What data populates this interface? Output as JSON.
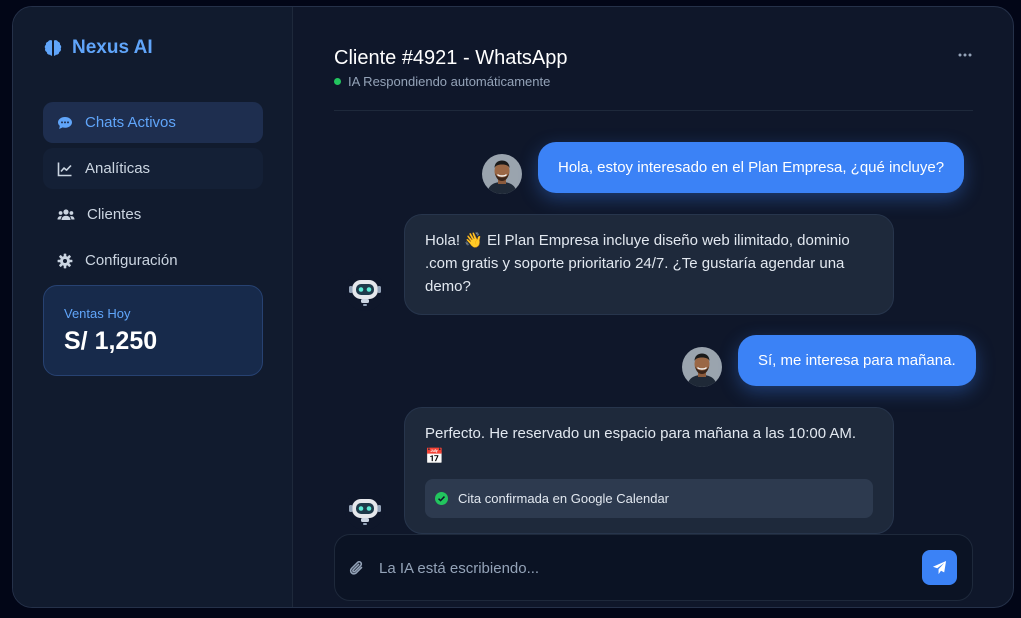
{
  "brand": {
    "name": "Nexus AI",
    "icon": "brain-icon",
    "color": "#60a5fa"
  },
  "nav": [
    {
      "label": "Chats Activos",
      "icon": "comment-icon",
      "active": true
    },
    {
      "label": "Analíticas",
      "icon": "chart-line-icon",
      "active": false
    },
    {
      "label": "Clientes",
      "icon": "users-icon",
      "active": false
    },
    {
      "label": "Configuración",
      "icon": "gear-icon",
      "active": false
    }
  ],
  "sales": {
    "label": "Ventas Hoy",
    "value": "S/ 1,250"
  },
  "chat": {
    "title": "Cliente #4921 - WhatsApp",
    "status": "IA Respondiendo automáticamente",
    "status_color": "#22c55e"
  },
  "messages": [
    {
      "from": "user",
      "text": "Hola, estoy interesado en el Plan Empresa, ¿qué incluye?"
    },
    {
      "from": "ai",
      "text": "Hola! 👋 El Plan Empresa incluye diseño web ilimitado, dominio .com gratis y soporte prioritario 24/7. ¿Te gustaría agendar una demo?"
    },
    {
      "from": "user",
      "text": "Sí, me interesa para mañana."
    },
    {
      "from": "ai",
      "text": "Perfecto. He reservado un espacio para mañana a las 10:00 AM. 📅",
      "confirmation": "Cita confirmada en Google Calendar"
    }
  ],
  "composer": {
    "placeholder": "La IA está escribiendo...",
    "value": ""
  },
  "colors": {
    "accent": "#3b82f6",
    "background": "#0f172a",
    "sidebar": "#111b2e",
    "success": "#22c55e"
  }
}
